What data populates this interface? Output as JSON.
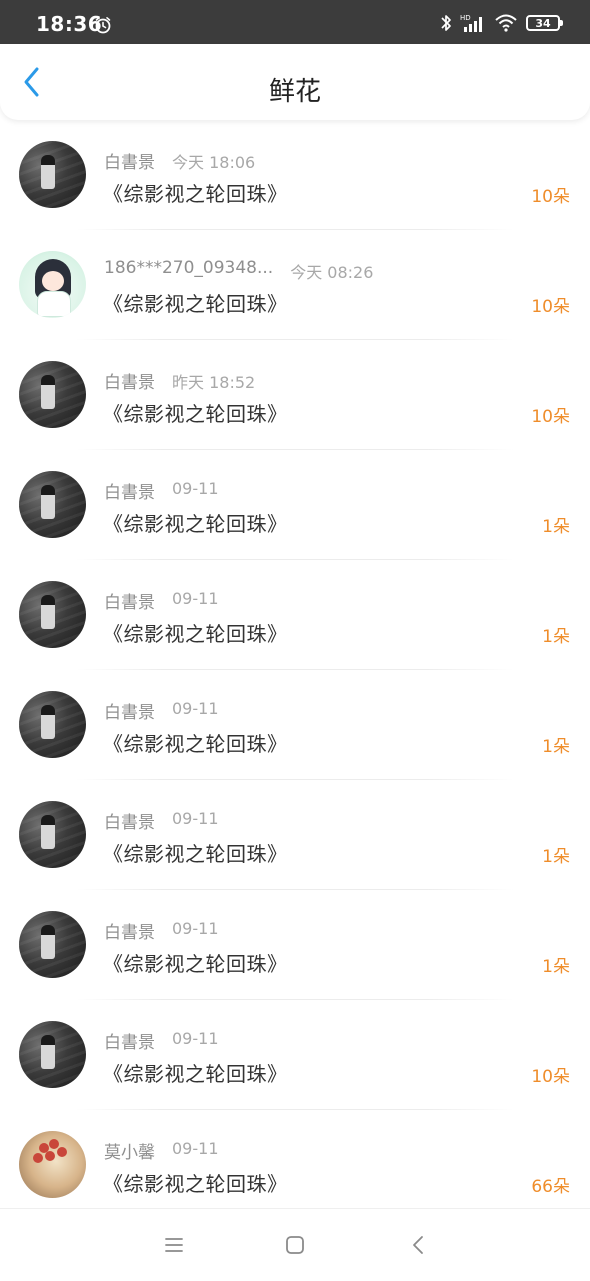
{
  "status_bar": {
    "time": "18:36",
    "battery": "34",
    "network": "HD",
    "icons": [
      "alarm-icon",
      "bluetooth-icon",
      "cellular-signal-icon",
      "wifi-icon",
      "battery-icon"
    ]
  },
  "header": {
    "title": "鲜花",
    "back_icon": "chevron-left-icon",
    "accent_color": "#2b9ae8"
  },
  "items": [
    {
      "user": "白書景",
      "time": "今天 18:06",
      "title": "《综影视之轮回珠》",
      "count": "10朵",
      "avatar": "dark"
    },
    {
      "user": "186***270_09348...",
      "time": "今天 08:26",
      "title": "《综影视之轮回珠》",
      "count": "10朵",
      "avatar": "anime"
    },
    {
      "user": "白書景",
      "time": "昨天 18:52",
      "title": "《综影视之轮回珠》",
      "count": "10朵",
      "avatar": "dark"
    },
    {
      "user": "白書景",
      "time": "09-11",
      "title": "《综影视之轮回珠》",
      "count": "1朵",
      "avatar": "dark"
    },
    {
      "user": "白書景",
      "time": "09-11",
      "title": "《综影视之轮回珠》",
      "count": "1朵",
      "avatar": "dark"
    },
    {
      "user": "白書景",
      "time": "09-11",
      "title": "《综影视之轮回珠》",
      "count": "1朵",
      "avatar": "dark"
    },
    {
      "user": "白書景",
      "time": "09-11",
      "title": "《综影视之轮回珠》",
      "count": "1朵",
      "avatar": "dark"
    },
    {
      "user": "白書景",
      "time": "09-11",
      "title": "《综影视之轮回珠》",
      "count": "1朵",
      "avatar": "dark"
    },
    {
      "user": "白書景",
      "time": "09-11",
      "title": "《综影视之轮回珠》",
      "count": "10朵",
      "avatar": "dark"
    },
    {
      "user": "莫小馨",
      "time": "09-11",
      "title": "《综影视之轮回珠》",
      "count": "66朵",
      "avatar": "flowers"
    }
  ],
  "colors": {
    "count": "#ef8d2b",
    "status_bar": "#3c3c3c",
    "name": "#8f8f8f",
    "title": "#333333"
  },
  "nav": {
    "icons": [
      "menu-icon",
      "home-square-icon",
      "back-triangle-icon"
    ]
  }
}
